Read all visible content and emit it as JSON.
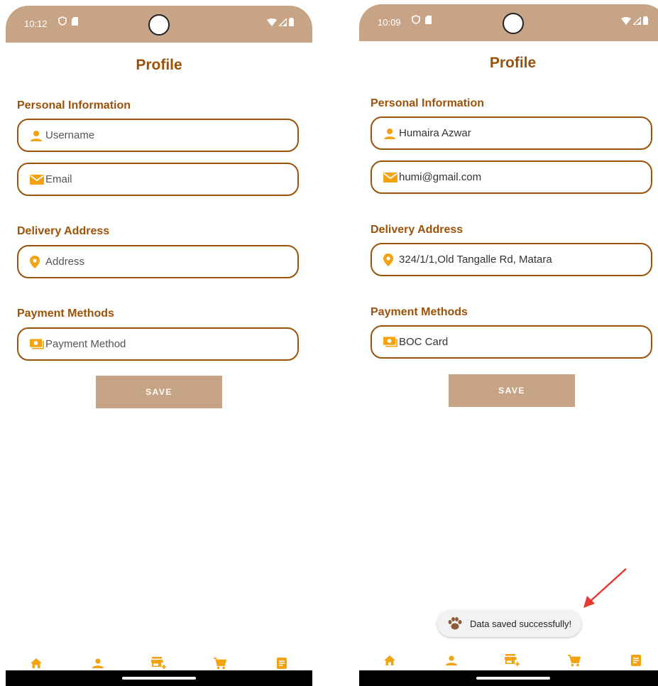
{
  "colors": {
    "brand": "#9b5209",
    "accent": "#f2a30f",
    "statusbar": "#c7a485",
    "arrow": "#e53935"
  },
  "left": {
    "status": {
      "time": "10:12"
    },
    "title": "Profile",
    "sections": {
      "personal": "Personal Information",
      "delivery": "Delivery Address",
      "payment": "Payment Methods"
    },
    "fields": {
      "username": {
        "placeholder": "Username"
      },
      "email": {
        "placeholder": "Email"
      },
      "address": {
        "placeholder": "Address"
      },
      "payment": {
        "placeholder": "Payment Method"
      }
    },
    "save_label": "SAVE"
  },
  "right": {
    "status": {
      "time": "10:09"
    },
    "title": "Profile",
    "sections": {
      "personal": "Personal Information",
      "delivery": "Delivery Address",
      "payment": "Payment Methods"
    },
    "fields": {
      "username": {
        "value": "Humaira Azwar"
      },
      "email": {
        "value": "humi@gmail.com"
      },
      "address": {
        "value": "324/1/1,Old Tangalle Rd, Matara"
      },
      "payment": {
        "value": "BOC Card"
      }
    },
    "save_label": "SAVE",
    "toast": "Data saved successfully!"
  },
  "nav_items": [
    "home-icon",
    "profile-icon",
    "add-store-icon",
    "cart-icon",
    "orders-icon"
  ]
}
